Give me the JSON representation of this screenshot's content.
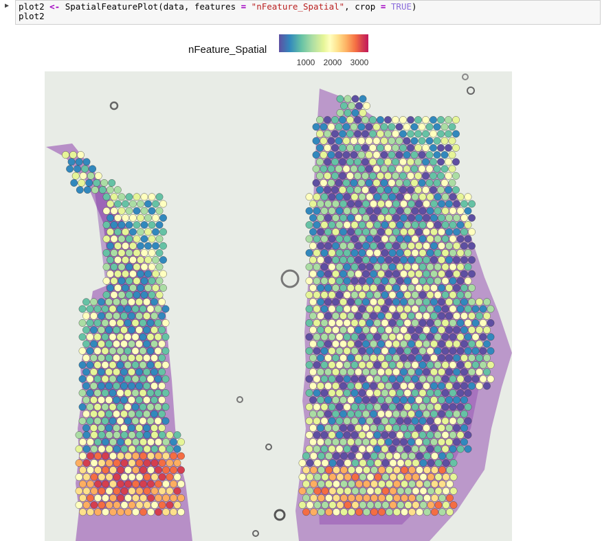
{
  "code_cell": {
    "run_marker": "▶",
    "line1": {
      "var": "plot2 ",
      "assign": "<-",
      "func": " SpatialFeaturePlot(data, features ",
      "eq1": "=",
      "str": " \"nFeature_Spatial\"",
      "mid": ", crop ",
      "eq2": "=",
      "bool": " TRUE",
      "end": ")"
    },
    "line2": "plot2"
  },
  "legend": {
    "title": "nFeature_Spatial",
    "ticks": [
      "1000",
      "2000",
      "3000"
    ]
  },
  "colors": {
    "scale": [
      "#5e4fa2",
      "#3288bd",
      "#66c2a5",
      "#abdda4",
      "#e6f598",
      "#ffffbf",
      "#fee08b",
      "#fdae61",
      "#f46d43",
      "#d53e4f",
      "#c2185b"
    ],
    "tissue": "#7b2d99",
    "background": "#e8ece6"
  }
}
